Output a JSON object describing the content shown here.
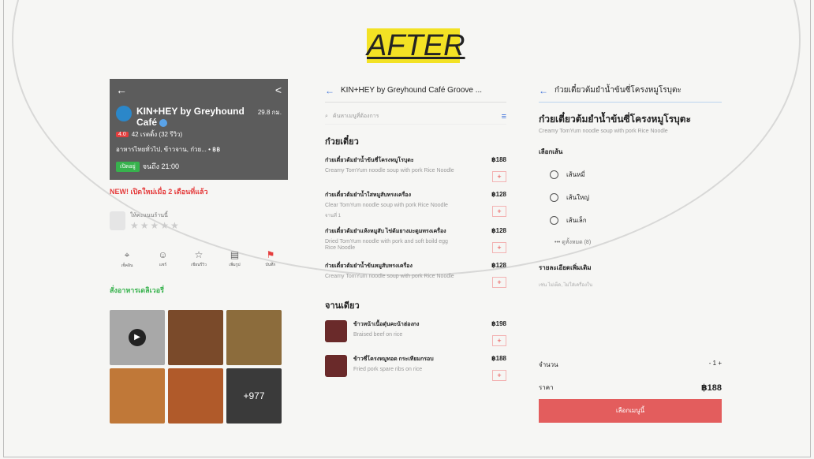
{
  "after_label": "AFTER",
  "panel1": {
    "back": "←",
    "share": "<",
    "name": "KIN+HEY by Greyhound Café",
    "distance": "29.8 กม.",
    "rating": "4.0",
    "rating_text": "42 เรตติ้ง (32 รีวิว)",
    "category": "อาหารไทยทั่วไป, ข้าวจาน, ก๋วย... • ฿฿",
    "open_badge": "เปิดอยู่",
    "hours": "จนถึง 21:00",
    "new_tag": "NEW! เปิดใหม่เมื่อ 2 เดือนที่แล้ว",
    "review_label": "ให้คะแนนร้านนี้",
    "stars": "★★★★★",
    "actions": [
      {
        "icon": "⌖",
        "label": "เช็คอิน"
      },
      {
        "icon": "☺",
        "label": "แชร์"
      },
      {
        "icon": "☆",
        "label": "เขียนรีวิว"
      },
      {
        "icon": "▤",
        "label": "เพิ่มรูป"
      },
      {
        "icon": "⚑",
        "label": "บันทึก"
      }
    ],
    "delivery_title": "สั่งอาหารเดลิเวอรี่",
    "more_photos": "+977",
    "play": "▶"
  },
  "panel2": {
    "back": "←",
    "title": "KIN+HEY by Greyhound Café Groove ...",
    "search_placeholder": "ค้นหาเมนูที่ต้องการ",
    "section1": "ก๋วยเตี๋ยว",
    "items1": [
      {
        "name": "ก๋วยเตี๋ยวต้มยำน้ำข้นซี่โครงหมูโรบุตะ",
        "desc": "Creamy TomYum noodle soup with pork Rice Noodle",
        "price": "฿188",
        "note": ""
      },
      {
        "name": "ก๋วยเตี๋ยวต้มยำน้ำใสหมูสับทรงเครื่อง",
        "desc": "Clear TomYum noodle soup with pork Rice Noodle",
        "price": "฿128",
        "note": "จานที่ 1"
      },
      {
        "name": "ก๋วยเตี๋ยวต้มยำแห้งหมูสับ ไข่ต้มยางมะตูมทรงเครื่อง",
        "desc": "Dried TomYum noodle with pork and soft boild egg Rice Noodle",
        "price": "฿128",
        "note": ""
      },
      {
        "name": "ก๋วยเตี๋ยวต้มยำน้ำข้นหมูสับทรงเครื่อง",
        "desc": "Creamy TomYum noodle soup with pork Rice Noodle",
        "price": "฿128",
        "note": ""
      }
    ],
    "section2": "จานเดียว",
    "items2": [
      {
        "name": "ข้าวหน้าเนื้อตุ๋นคะน้าฮ่องกง",
        "desc": "Braised beef on rice",
        "price": "฿198"
      },
      {
        "name": "ข้าวซี่โครงหมูทอด กระเทียมกรอบ",
        "desc": "Fried pork spare ribs on rice",
        "price": "฿188"
      }
    ],
    "add": "+"
  },
  "panel3": {
    "back": "←",
    "title": "ก๋วยเตี๋ยวต้มยำน้ำข้นซี่โครงหมูโรบุตะ",
    "dish_title": "ก๋วยเตี๋ยวต้มยำน้ำข้นซี่โครงหมูโรบุตะ",
    "dish_desc": "Creamy TomYum noodle soup with pork Rice Noodle",
    "option_title": "เลือกเส้น",
    "options": [
      "เส้นหมี่",
      "เส้นใหญ่",
      "เส้นเล็ก"
    ],
    "more": "••• ดูทั้งหมด (8)",
    "extra_title": "รายละเอียดเพิ่มเติม",
    "extra_placeholder": "เช่น ไม่เผ็ด, ไม่ใส่เครื่องใน",
    "qty_label": "จำนวน",
    "qty_value": "- 1 +",
    "price_label": "ราคา",
    "price_value": "฿188",
    "order_button": "เลือกเมนูนี้"
  }
}
